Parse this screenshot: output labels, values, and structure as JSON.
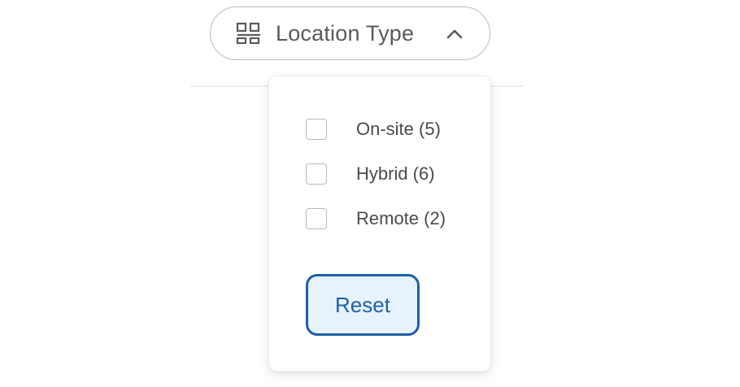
{
  "filter": {
    "label": "Location Type",
    "icon": "location-type-icon",
    "expanded": true
  },
  "options": [
    {
      "label": "On-site (5)",
      "checked": false
    },
    {
      "label": "Hybrid (6)",
      "checked": false
    },
    {
      "label": "Remote (2)",
      "checked": false
    }
  ],
  "reset": {
    "label": "Reset"
  },
  "colors": {
    "accent": "#1f5fa8",
    "accent_bg": "#e6f3fb",
    "text": "#4a4a4a",
    "border": "#bdbdbd"
  }
}
